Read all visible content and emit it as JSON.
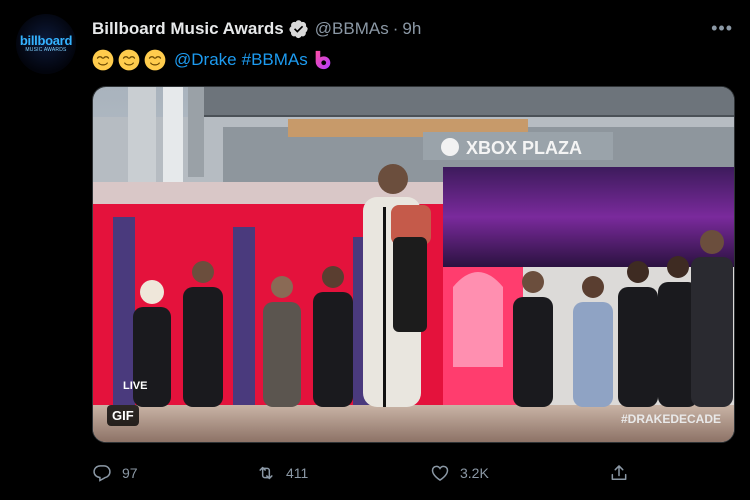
{
  "tweet": {
    "display_name": "Billboard Music Awards",
    "handle": "@BBMAs",
    "separator": "·",
    "time": "9h",
    "more_label": "•••",
    "avatar": {
      "logo_top": "billboard",
      "logo_bottom": "MUSIC AWARDS"
    },
    "mention": "@Drake",
    "hashtag": "#BBMAs",
    "emoji": [
      "relieved-face",
      "relieved-face",
      "relieved-face"
    ],
    "media": {
      "badge": "GIF",
      "signs": {
        "plaza": "XBOX PLAZA",
        "live": "LIVE",
        "hashtag": "#DRAKEDECADE"
      }
    },
    "actions": {
      "reply_count": "97",
      "retweet_count": "411",
      "like_count": "3.2K"
    }
  },
  "colors": {
    "accent": "#1d9bf0",
    "muted": "#8b98a5",
    "verified": "#d9d9d9",
    "stage_red": "#e4123c"
  }
}
